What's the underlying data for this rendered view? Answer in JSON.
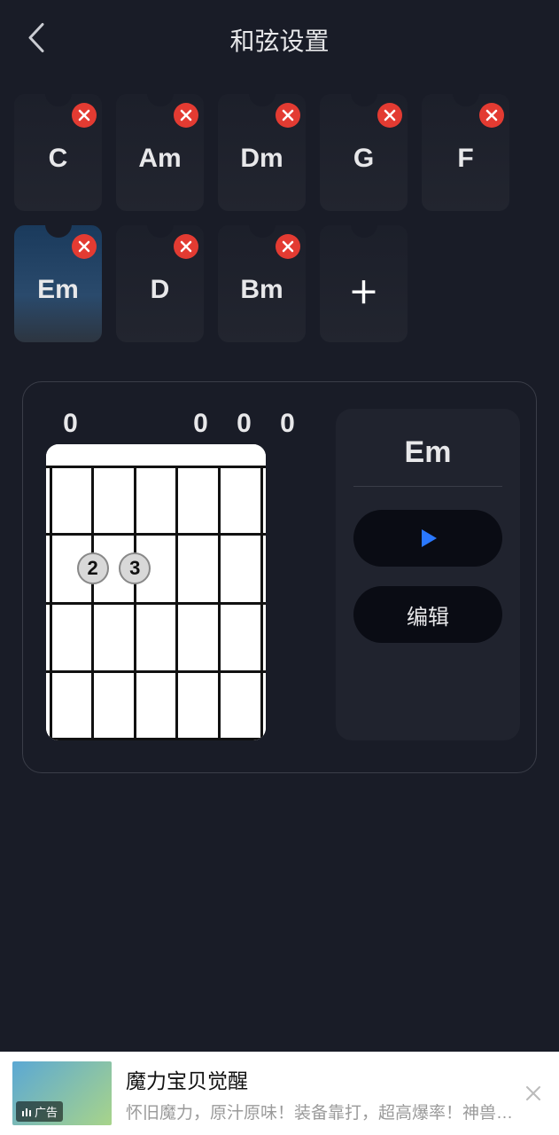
{
  "header": {
    "title": "和弦设置"
  },
  "chords": [
    {
      "name": "C",
      "selected": false
    },
    {
      "name": "Am",
      "selected": false
    },
    {
      "name": "Dm",
      "selected": false
    },
    {
      "name": "G",
      "selected": false
    },
    {
      "name": "F",
      "selected": false
    },
    {
      "name": "Em",
      "selected": true
    },
    {
      "name": "D",
      "selected": false
    },
    {
      "name": "Bm",
      "selected": false
    }
  ],
  "detail": {
    "chord_name": "Em",
    "open_strings": [
      "0",
      "",
      "",
      "0",
      "0",
      "0"
    ],
    "fingers": [
      {
        "string": 2,
        "fret": 2,
        "label": "2"
      },
      {
        "string": 3,
        "fret": 2,
        "label": "3"
      }
    ],
    "edit_label": "编辑"
  },
  "ad": {
    "tag": "广告",
    "title": "魔力宝贝觉醒",
    "desc": "怀旧魔力，原汁原味！装备靠打，超高爆率！神兽…"
  }
}
